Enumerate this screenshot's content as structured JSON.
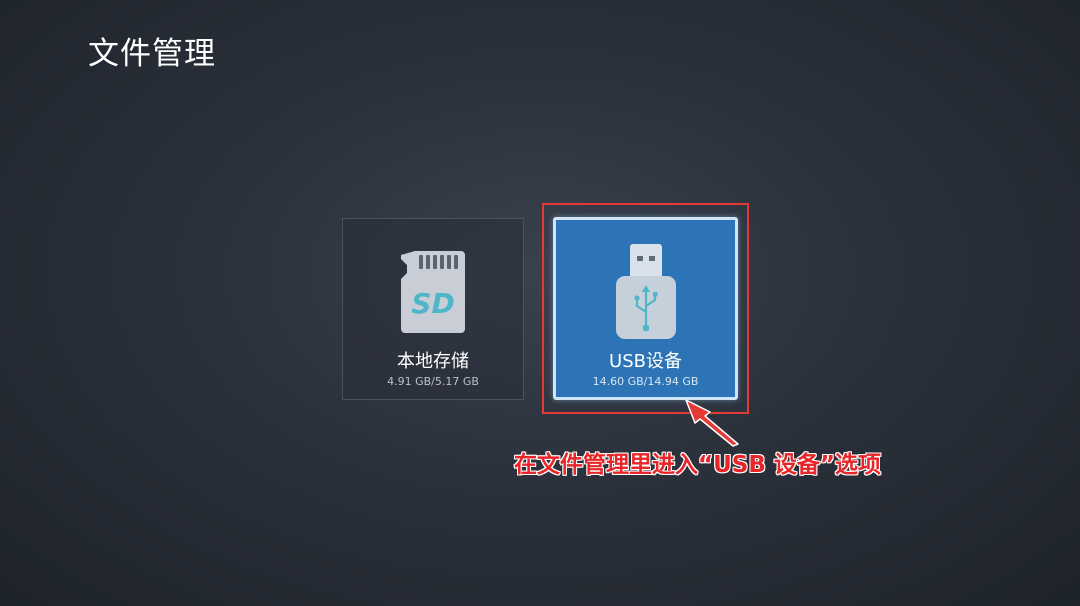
{
  "header": {
    "title": "文件管理"
  },
  "storage": [
    {
      "label": "本地存储",
      "usage": "4.91 GB/5.17 GB",
      "icon": "sd-card-icon"
    },
    {
      "label": "USB设备",
      "usage": "14.60 GB/14.94 GB",
      "icon": "usb-drive-icon",
      "selected": true
    }
  ],
  "annotation": {
    "text": "在文件管理里进入“USB 设备”选项",
    "color": "#e8262a"
  },
  "colors": {
    "selected_tile": "#2c74b5",
    "highlight": "#e53935"
  }
}
